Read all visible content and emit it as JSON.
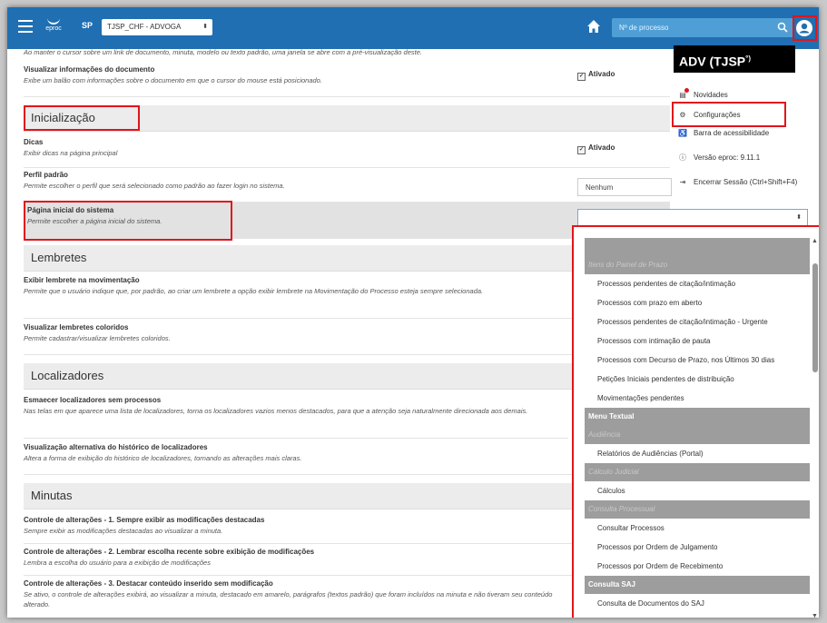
{
  "header": {
    "app_logo_text": "eproc",
    "state": "SP",
    "profile_select": "TJSP_CHF - ADVOGA",
    "search_placeholder": "Nº de processo"
  },
  "content": {
    "cut_text": "Ao manter o cursor sobre um link de documento, minuta, modelo ou texto padrão, uma janela se abre com a pré-visualização deste.",
    "rows": [
      {
        "title": "Visualizar informações do documento",
        "desc": "Exibe um balão com informações sobre o documento em que o cursor do mouse está posicionado.",
        "value": "Ativado"
      },
      {
        "section": "Inicialização"
      },
      {
        "title": "Dicas",
        "desc": "Exibir dicas na página principal",
        "value": "Ativado"
      },
      {
        "title": "Perfil padrão",
        "desc": "Permite escolher o perfil que será selecionado como padrão ao fazer login no sistema.",
        "value": "Nenhum"
      },
      {
        "title": "Página inicial do sistema",
        "desc": "Permite escolher a página inicial do sistema."
      },
      {
        "section": "Lembretes"
      },
      {
        "title": "Exibir lembrete na movimentação",
        "desc": "Permite que o usuário indique que, por padrão, ao criar um lembrete a opção exibir lembrete na Movimentação do Processo esteja sempre selecionada."
      },
      {
        "title": "Visualizar lembretes coloridos",
        "desc": "Permite cadastrar/visualizar lembretes coloridos."
      },
      {
        "section": "Localizadores"
      },
      {
        "title": "Esmaecer localizadores sem processos",
        "desc": "Nas telas em que aparece uma lista de localizadores, torna os localizadores vazios menos destacados, para que a atenção seja naturalmente direcionada aos demais."
      },
      {
        "title": "Visualização alternativa do histórico de localizadores",
        "desc": "Altera a forma de exibição do histórico de localizadores, tornando as alterações mais claras."
      },
      {
        "section": "Minutas"
      },
      {
        "title": "Controle de alterações - 1. Sempre exibir as modificações destacadas",
        "desc": "Sempre exibir as modificações destacadas ao visualizar a minuta."
      },
      {
        "title": "Controle de alterações - 2. Lembrar escolha recente sobre exibição de modificações",
        "desc": "Lembra a escolha do usuário para a exibição de modificações"
      },
      {
        "title": "Controle de alterações - 3. Destacar conteúdo inserido sem modificação",
        "desc": "Se ativo, o controle de alterações exibirá, ao visualizar a minuta, destacado em amarelo, parágrafos (textos padrão) que foram incluídos na minuta e não tiveram seu conteúdo alterado."
      }
    ]
  },
  "user_menu": {
    "name": "ADV (TJSP",
    "name_suffix": "°)",
    "items": [
      {
        "label": "Novidades",
        "icon": "news-icon"
      },
      {
        "label": "Configurações",
        "icon": "gear-icon"
      },
      {
        "label": "Barra de acessibilidade",
        "icon": "accessibility-icon"
      },
      {
        "label": "Versão eproc: 9.11.1",
        "icon": "info-icon"
      },
      {
        "label": "Encerrar Sessão (Ctrl+Shift+F4)",
        "icon": "logout-icon"
      }
    ]
  },
  "dropdown": {
    "items": [
      {
        "type": "blank",
        "label": ""
      },
      {
        "type": "sub",
        "label": "Itens do Painel de Prazo"
      },
      {
        "type": "opt",
        "label": "Processos pendentes de citação/intimação"
      },
      {
        "type": "opt",
        "label": "Processos com prazo em aberto"
      },
      {
        "type": "opt",
        "label": "Processos pendentes de citação/intimação - Urgente"
      },
      {
        "type": "opt",
        "label": "Processos com intimação de pauta"
      },
      {
        "type": "opt",
        "label": "Processos com Decurso de Prazo, nos Últimos 30 dias"
      },
      {
        "type": "opt",
        "label": "Petições Iniciais pendentes de distribuição"
      },
      {
        "type": "opt",
        "label": "Movimentações pendentes"
      },
      {
        "type": "grp",
        "label": "Menu Textual"
      },
      {
        "type": "sub",
        "label": "Audiência"
      },
      {
        "type": "opt",
        "label": "Relatórios de Audiências (Portal)"
      },
      {
        "type": "sub",
        "label": "Cálculo Judicial"
      },
      {
        "type": "opt",
        "label": "Cálculos"
      },
      {
        "type": "sub",
        "label": "Consulta Processual"
      },
      {
        "type": "opt",
        "label": "Consultar Processos"
      },
      {
        "type": "opt",
        "label": "Processos por Ordem de Julgamento"
      },
      {
        "type": "opt",
        "label": "Processos por Ordem de Recebimento"
      },
      {
        "type": "grp",
        "label": "Consulta SAJ"
      },
      {
        "type": "opt",
        "label": "Consulta de Documentos do SAJ"
      }
    ]
  }
}
